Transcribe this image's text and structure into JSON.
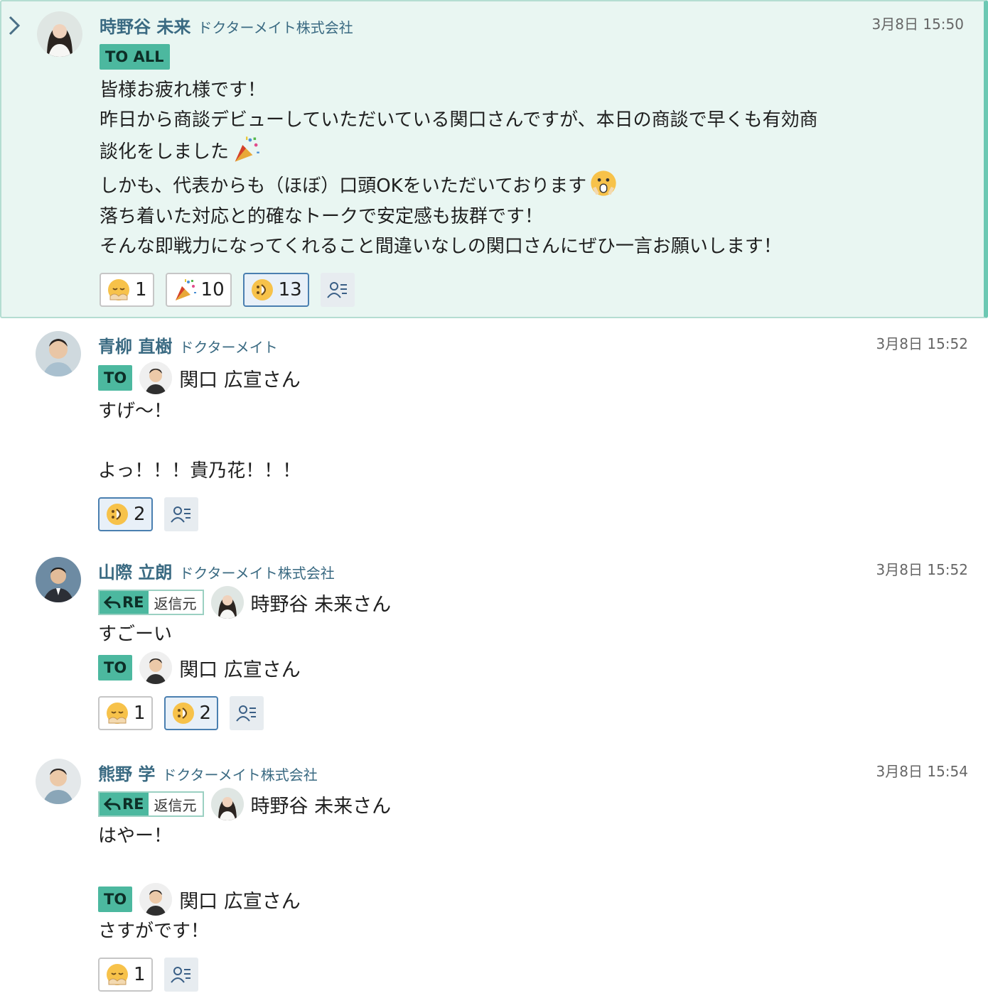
{
  "messages": [
    {
      "author": "時野谷 未来",
      "org": "ドクターメイト株式会社",
      "time": "3月8日 15:50",
      "to_all": "TO ALL",
      "lines": [
        "皆様お疲れ様です！",
        "昨日から商談デビューしていただいている関口さんですが、本日の商談で早くも有効商",
        "談化をしました",
        "しかも、代表からも（ほぼ）口頭OKをいただいております",
        "落ち着いた対応と的確なトークで安定感も抜群です！",
        "そんな即戦力になってくれること間違いなしの関口さんにぜひ一言お願いします！"
      ],
      "reactions": [
        {
          "emoji": "bow-face-icon",
          "count": "1"
        },
        {
          "emoji": "party-popper-icon",
          "count": "10"
        },
        {
          "emoji": "smile-face-icon",
          "count": "13"
        }
      ]
    },
    {
      "author": "青柳 直樹",
      "org": "ドクターメイト",
      "time": "3月8日 15:52",
      "to_label": "TO",
      "to_name": "関口 広宣さん",
      "lines": [
        "すげ〜！",
        "よっ！！！貴乃花！！！"
      ],
      "reactions": [
        {
          "emoji": "smile-face-icon",
          "count": "2"
        }
      ]
    },
    {
      "author": "山際 立朗",
      "org": "ドクターメイト株式会社",
      "time": "3月8日 15:52",
      "re_label": "RE",
      "re_src": "返信元",
      "re_name": "時野谷 未来さん",
      "lines": [
        "すごーい"
      ],
      "to_label": "TO",
      "to_name": "関口 広宣さん",
      "reactions": [
        {
          "emoji": "bow-face-icon",
          "count": "1"
        },
        {
          "emoji": "smile-face-icon",
          "count": "2"
        }
      ]
    },
    {
      "author": "熊野 学",
      "org": "ドクターメイト株式会社",
      "time": "3月8日 15:54",
      "re_label": "RE",
      "re_src": "返信元",
      "re_name": "時野谷 未来さん",
      "lines": [
        "はやー！",
        "さすがです！"
      ],
      "to_label": "TO",
      "to_name": "関口 広宣さん",
      "reactions": [
        {
          "emoji": "bow-face-icon",
          "count": "1"
        }
      ]
    }
  ],
  "colors": {
    "highlight_bg": "#e9f6f2",
    "tag_bg": "#4cb89f",
    "name_color": "#3a6a82"
  }
}
